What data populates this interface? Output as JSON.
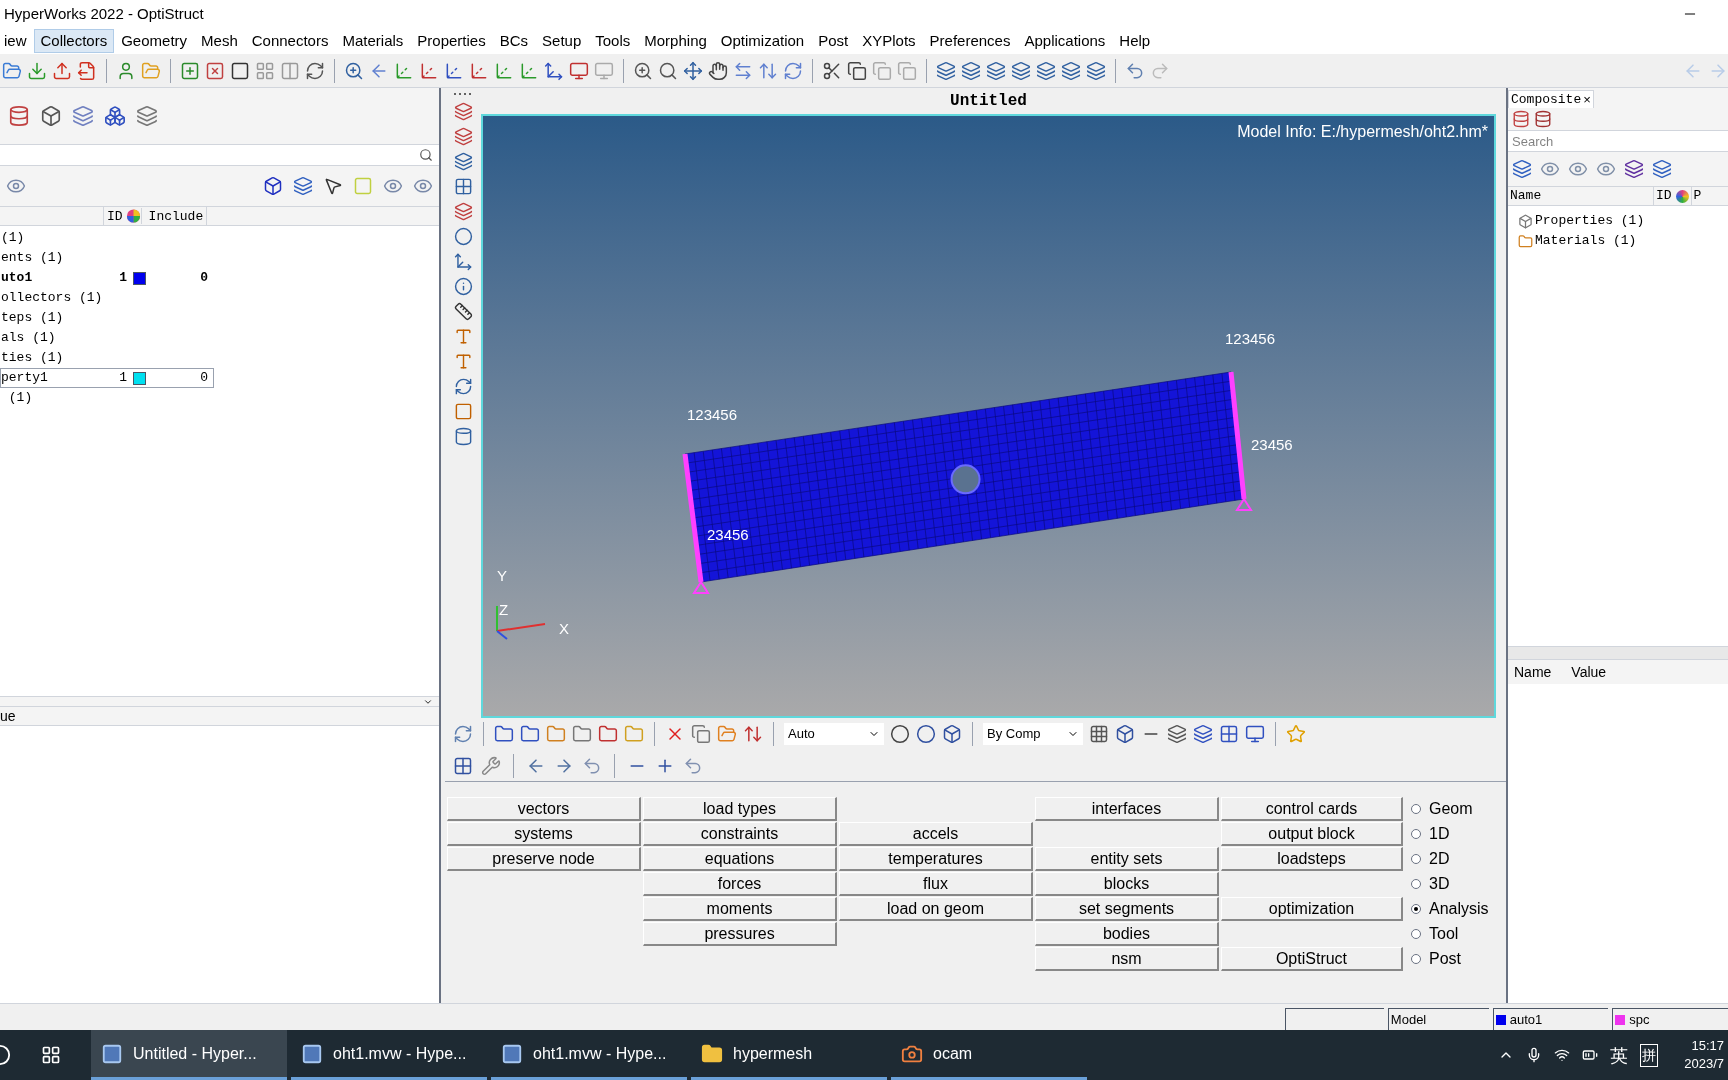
{
  "window": {
    "title": "HyperWorks 2022 - OptiStruct"
  },
  "menu_bar": [
    {
      "label": "iew",
      "hovered": false
    },
    {
      "label": "Collectors",
      "hovered": true
    },
    {
      "label": "Geometry",
      "hovered": false
    },
    {
      "label": "Mesh",
      "hovered": false
    },
    {
      "label": "Connectors",
      "hovered": false
    },
    {
      "label": "Materials",
      "hovered": false
    },
    {
      "label": "Properties",
      "hovered": false
    },
    {
      "label": "BCs",
      "hovered": false
    },
    {
      "label": "Setup",
      "hovered": false
    },
    {
      "label": "Tools",
      "hovered": false
    },
    {
      "label": "Morphing",
      "hovered": false
    },
    {
      "label": "Optimization",
      "hovered": false
    },
    {
      "label": "Post",
      "hovered": false
    },
    {
      "label": "XYPlots",
      "hovered": false
    },
    {
      "label": "Preferences",
      "hovered": false
    },
    {
      "label": "Applications",
      "hovered": false
    },
    {
      "label": "Help",
      "hovered": false
    }
  ],
  "model_browser": {
    "columns": [
      "ID",
      "Include"
    ],
    "rows": [
      {
        "name": "(1)",
        "current": false,
        "selected": false
      },
      {
        "name": "ents (1)",
        "current": false,
        "selected": false
      },
      {
        "name": "uto1",
        "id": "1",
        "color": "#0000ee",
        "include": "0",
        "current": true,
        "selected": false
      },
      {
        "name": "ollectors (1)",
        "current": false,
        "selected": false
      },
      {
        "name": "teps (1)",
        "current": false,
        "selected": false
      },
      {
        "name": "als (1)",
        "current": false,
        "selected": false
      },
      {
        "name": "ties (1)",
        "current": false,
        "selected": false
      },
      {
        "name": "perty1",
        "id": "1",
        "color": "#00e0f0",
        "include": "0",
        "current": false,
        "selected": true
      },
      {
        "name": " (1)",
        "current": false,
        "selected": false
      }
    ],
    "value_header": "ue"
  },
  "viewport": {
    "title": "Untitled",
    "model_info": "Model Info: E:/hypermesh/oht2.hm*",
    "spc_labels": [
      "123456",
      "23456",
      "123456",
      "23456"
    ],
    "axes": [
      "Y",
      "Z",
      "X"
    ]
  },
  "graphics_toolbar": {
    "combos": [
      {
        "value": "Auto"
      },
      {
        "value": "By Comp"
      }
    ]
  },
  "panel_menu": {
    "rows": [
      [
        "vectors",
        "load types",
        null,
        "interfaces",
        "control cards"
      ],
      [
        "systems",
        "constraints",
        "accels",
        null,
        "output block"
      ],
      [
        "preserve node",
        "equations",
        "temperatures",
        "entity sets",
        "loadsteps"
      ],
      [
        null,
        "forces",
        "flux",
        "blocks",
        null
      ],
      [
        null,
        "moments",
        "load on geom",
        "set segments",
        "optimization"
      ],
      [
        null,
        "pressures",
        null,
        "bodies",
        null
      ],
      [
        null,
        null,
        null,
        "nsm",
        "OptiStruct"
      ]
    ],
    "radios": [
      {
        "label": "Geom",
        "selected": false
      },
      {
        "label": "1D",
        "selected": false
      },
      {
        "label": "2D",
        "selected": false
      },
      {
        "label": "3D",
        "selected": false
      },
      {
        "label": "Analysis",
        "selected": true
      },
      {
        "label": "Tool",
        "selected": false
      },
      {
        "label": "Post",
        "selected": false
      }
    ]
  },
  "composite_browser": {
    "tab": "Composite",
    "tab_close": "×",
    "search_placeholder": "Search",
    "columns": [
      "Name",
      "ID",
      "P"
    ],
    "items": [
      {
        "label": "Properties (1)",
        "kind": "properties"
      },
      {
        "label": "Materials (1)",
        "kind": "materials"
      }
    ],
    "attribute_columns": [
      "Name",
      "Value"
    ]
  },
  "status_bar": [
    {
      "text": "Model"
    },
    {
      "text": "auto1",
      "color": "#0000ee"
    },
    {
      "text": "spc",
      "color": "#ee33ee"
    }
  ],
  "taskbar": {
    "items": [
      {
        "label": "Untitled - Hyper...",
        "kind": "app",
        "selected": true
      },
      {
        "label": "oht1.mvw - Hype...",
        "kind": "app",
        "selected": false
      },
      {
        "label": "oht1.mvw - Hype...",
        "kind": "app",
        "selected": false
      },
      {
        "label": "hypermesh",
        "kind": "folder",
        "selected": false
      },
      {
        "label": "ocam",
        "kind": "recorder",
        "selected": false
      }
    ],
    "tray": [
      "英",
      "拼"
    ],
    "time": "15:17",
    "date": "2023/7"
  }
}
